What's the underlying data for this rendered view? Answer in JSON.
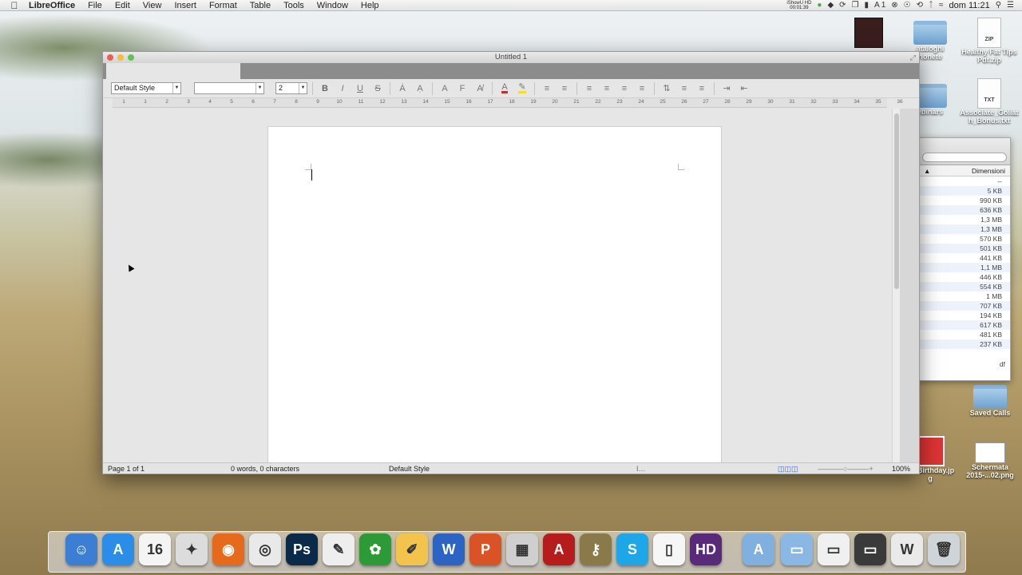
{
  "menubar": {
    "app": "LibreOffice",
    "items": [
      "File",
      "Edit",
      "View",
      "Insert",
      "Format",
      "Table",
      "Tools",
      "Window",
      "Help"
    ],
    "recorder_line1": "iShowU HD",
    "recorder_line2": "00:01:39",
    "clock": "dom 11:21",
    "status_text": "1"
  },
  "desktop": {
    "icons": [
      {
        "label1": "ataloghi",
        "label2": "rionete"
      },
      {
        "label1": "Healthy Fat Tips",
        "label2": "Pdf.zip",
        "file_type": "ZIP"
      },
      {
        "label1": "ebinars",
        "label2": ""
      },
      {
        "label1": "Associate_Goliat",
        "label2": "h_Bonus.txt",
        "file_type": "TXT"
      },
      {
        "label1": "Saved Calls",
        "label2": ""
      },
      {
        "label1": "aroBirthday.jp",
        "label2": "g"
      },
      {
        "label1": "Schermata",
        "label2": "2015-...02.png"
      }
    ]
  },
  "finder": {
    "col_header": "Dimensioni",
    "sizes": [
      "--",
      "5 KB",
      "990 KB",
      "636 KB",
      "1,3 MB",
      "1,3 MB",
      "570 KB",
      "501 KB",
      "441 KB",
      "1,1 MB",
      "446 KB",
      "554 KB",
      "1 MB",
      "707 KB",
      "194 KB",
      "617 KB",
      "481 KB",
      "237 KB"
    ],
    "partial": "df"
  },
  "window": {
    "title": "Untitled 1"
  },
  "toolbar": {
    "paragraph_style": "Default Style",
    "font_name": "",
    "font_size": "2"
  },
  "ruler": {
    "numbers": [
      "1",
      "1",
      "2",
      "3",
      "4",
      "5",
      "6",
      "7",
      "8",
      "9",
      "10",
      "11",
      "12",
      "13",
      "14",
      "15",
      "16",
      "17",
      "18",
      "19",
      "20",
      "21",
      "22",
      "23",
      "24",
      "25",
      "26",
      "27",
      "28",
      "29",
      "30",
      "31",
      "32",
      "33",
      "34",
      "35",
      "36"
    ]
  },
  "statusbar": {
    "page": "Page 1 of 1",
    "words": "0 words, 0 characters",
    "style": "Default Style",
    "zoom": "100%"
  },
  "colors": {
    "accent": "#d24444",
    "highlight": "#f3e02a",
    "font_color": "#c33030"
  }
}
